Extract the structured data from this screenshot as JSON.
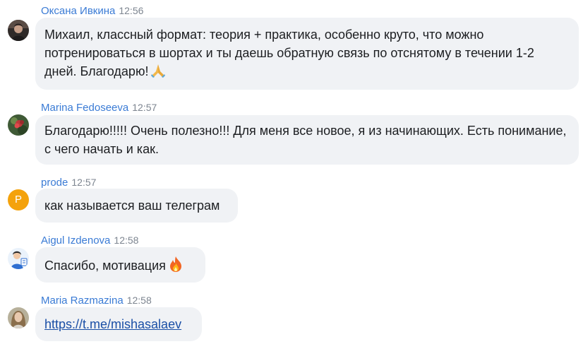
{
  "messages": [
    {
      "author": "Оксана Ивкина",
      "time": "12:56",
      "avatar": "user-photo-avatar",
      "text": "Михаил, классный формат: теория + практика, особенно круто, что можно потренироваться в шортах и ты даешь обратную связь по отснятому в течении 1-2 дней. Благодарю!",
      "emoji": "folded-hands-icon"
    },
    {
      "author": "Marina Fedoseeva",
      "time": "12:57",
      "avatar": "flower-photo-avatar",
      "text": "Благодарю!!!!! Очень полезно!!! Для меня все новое, я из начинающих. Есть понимание, с чего начать и как."
    },
    {
      "author": "prode",
      "time": "12:57",
      "avatar": "letter-avatar",
      "avatar_letter": "P",
      "avatar_color": "#f4a20c",
      "text": "как называется ваш телеграм"
    },
    {
      "author": "Aigul Izdenova",
      "time": "12:58",
      "avatar": "illustration-avatar",
      "text": "Спасибо, мотивация",
      "emoji": "fire-icon"
    },
    {
      "author": "Maria Razmazina",
      "time": "12:58",
      "avatar": "user-photo-avatar",
      "link": "https://t.me/mishasalaev"
    }
  ],
  "colors": {
    "author": "#3a7bd5",
    "time": "#7d8590",
    "bubble": "#f0f2f5",
    "text": "#1c1e21",
    "link": "#1a4fa6"
  }
}
